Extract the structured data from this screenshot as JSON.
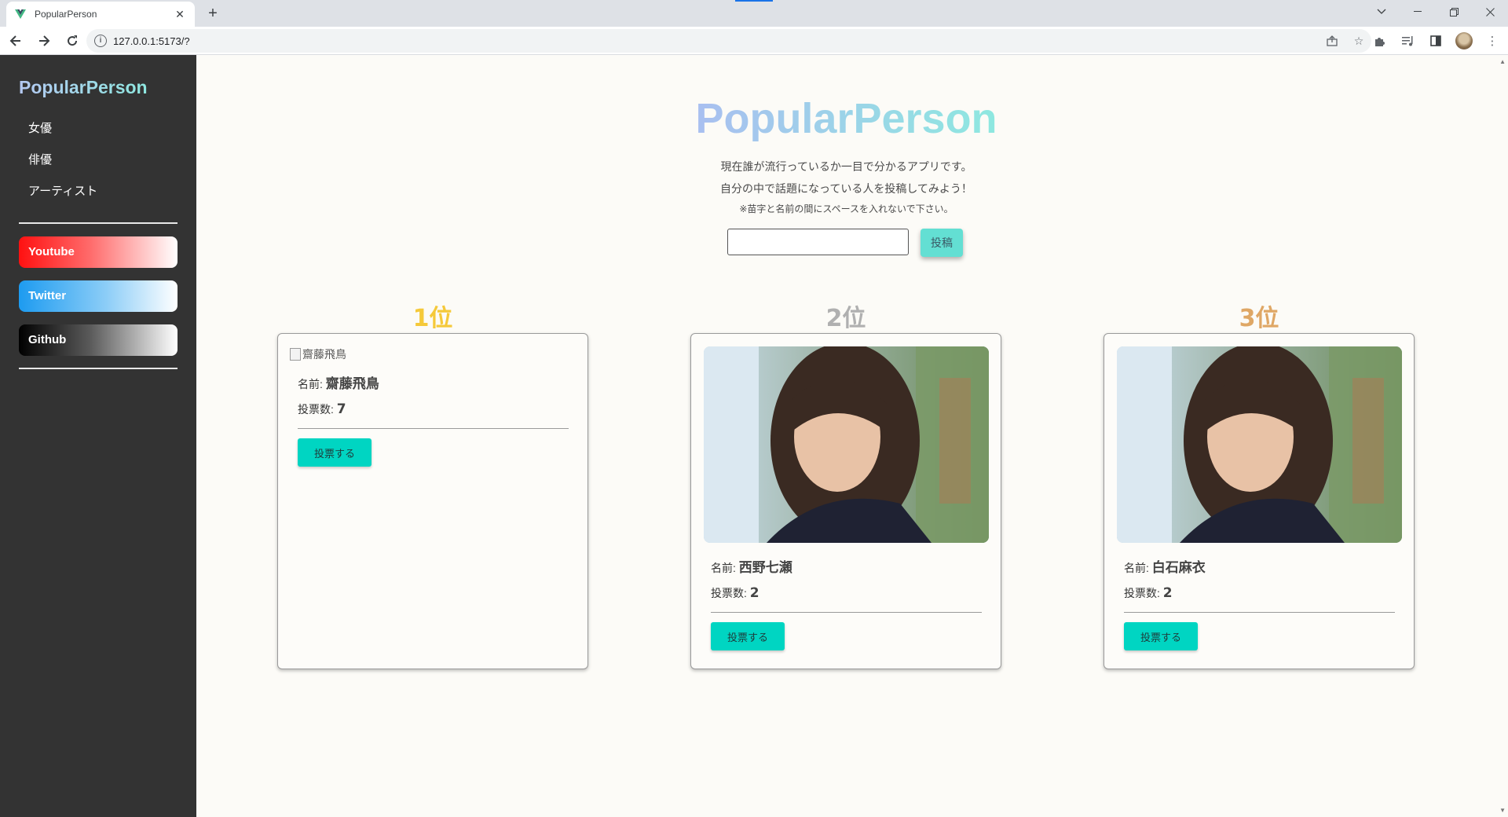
{
  "browser": {
    "tab_title": "PopularPerson",
    "tab_close": "✕",
    "new_tab": "+",
    "url": "127.0.0.1:5173/?",
    "accent": "#1a73e8"
  },
  "sidebar": {
    "brand": "PopularPerson",
    "nav": [
      {
        "label": "女優"
      },
      {
        "label": "俳優"
      },
      {
        "label": "アーティスト"
      }
    ],
    "links": [
      {
        "label": "Youtube",
        "color": "#ff1111"
      },
      {
        "label": "Twitter",
        "color": "#1d9bf0"
      },
      {
        "label": "Github",
        "color": "#000000"
      }
    ]
  },
  "hero": {
    "title": "PopularPerson",
    "line1": "現在誰が流行っているか一目で分かるアプリです。",
    "line2": "自分の中で話題になっている人を投稿してみよう！",
    "note": "※苗字と名前の間にスペースを入れないで下さい。",
    "input_value": "",
    "submit_label": "投稿",
    "submit_color": "#63dfd3"
  },
  "ranking": [
    {
      "rank": "1位",
      "color": "#f5c93a",
      "image_alt": "齋藤飛鳥",
      "name_label": "名前:",
      "name": "齋藤飛鳥",
      "votes_label": "投票数:",
      "votes": "7",
      "vote_button": "投票する"
    },
    {
      "rank": "2位",
      "color": "#b0b0b0",
      "name_label": "名前:",
      "name": "西野七瀬",
      "votes_label": "投票数:",
      "votes": "2",
      "vote_button": "投票する"
    },
    {
      "rank": "3位",
      "color": "#dfa765",
      "name_label": "名前:",
      "name": "白石麻衣",
      "votes_label": "投票数:",
      "votes": "2",
      "vote_button": "投票する"
    }
  ]
}
